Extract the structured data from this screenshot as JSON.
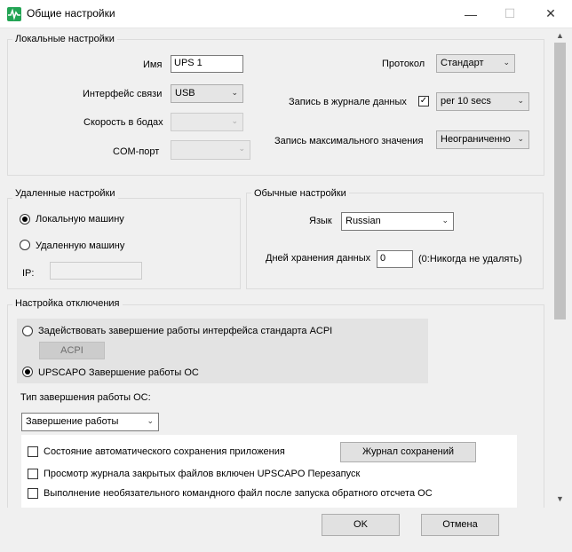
{
  "window": {
    "title": "Общие настройки"
  },
  "local": {
    "legend": "Локальные настройки",
    "name_label": "Имя",
    "name_value": "UPS 1",
    "interface_label": "Интерфейс связи",
    "interface_value": "USB",
    "baud_label": "Скорость в бодах",
    "baud_value": "",
    "com_label": "COM-порт",
    "com_value": "",
    "protocol_label": "Протокол",
    "protocol_value": "Стандарт",
    "log_label": "Запись в журнале данных",
    "log_checked": true,
    "log_value": "per 10 secs",
    "max_label": "Запись максимального значения",
    "max_value": "Неограниченно"
  },
  "remote": {
    "legend": "Удаленные настройки",
    "local_machine": "Локальную машину",
    "remote_machine": "Удаленную машину",
    "ip_label": "IP:",
    "ip_value": ""
  },
  "general": {
    "legend": "Обычные настройки",
    "lang_label": "Язык",
    "lang_value": "Russian",
    "days_label": "Дней хранения данных",
    "days_value": "0",
    "days_hint": "(0:Никогда не удалять)"
  },
  "shutdown": {
    "legend": "Настройка отключения",
    "acpi_option": "Задействовать завершение работы интерфейса стандарта ACPI",
    "acpi_button": "ACPI",
    "upscapo_option": "UPSCAPO Завершение работы ОС",
    "type_label": "Тип завершения работы ОС:",
    "type_value": "Завершение работы",
    "autosave": "Состояние автоматического сохранения приложения",
    "journal_button": "Журнал сохранений",
    "closed_files": "Просмотр журнала закрытых файлов включен UPSCAPO Перезапуск",
    "optional_cmd": "Выполнение необязательного командного файл после запуска обратного отсчета ОС"
  },
  "footer": {
    "ok": "OK",
    "cancel": "Отмена"
  }
}
